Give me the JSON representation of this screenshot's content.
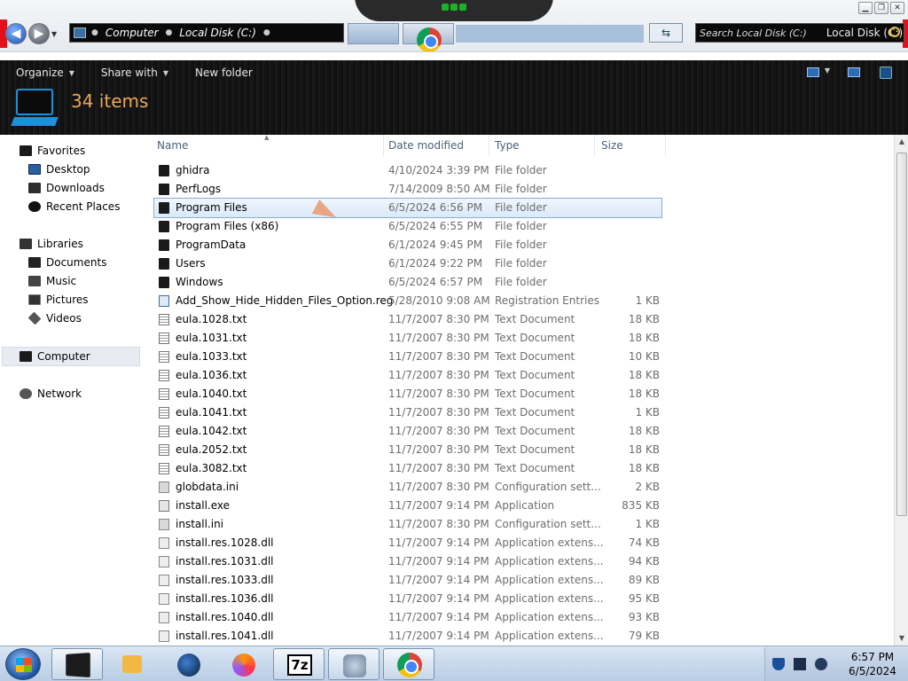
{
  "address": {
    "crumbs": [
      "Computer",
      "Local Disk (C:)"
    ],
    "search_placeholder": "Search Local Disk (C:)",
    "search_location": "Local Disk (C:)"
  },
  "toolbar": {
    "organize": "Organize",
    "share_with": "Share with",
    "new_folder": "New folder"
  },
  "header": {
    "item_count": "34 items"
  },
  "nav": {
    "favorites": "Favorites",
    "desktop": "Desktop",
    "downloads": "Downloads",
    "recent_places": "Recent Places",
    "libraries": "Libraries",
    "documents": "Documents",
    "music": "Music",
    "pictures": "Pictures",
    "videos": "Videos",
    "computer": "Computer",
    "network": "Network"
  },
  "columns": {
    "name": "Name",
    "date": "Date modified",
    "type": "Type",
    "size": "Size"
  },
  "files": [
    {
      "name": "ghidra",
      "date": "4/10/2024 3:39 PM",
      "type": "File folder",
      "size": "",
      "icon": "folder-icon"
    },
    {
      "name": "PerfLogs",
      "date": "7/14/2009 8:50 AM",
      "type": "File folder",
      "size": "",
      "icon": "folder-icon"
    },
    {
      "name": "Program Files",
      "date": "6/5/2024 6:56 PM",
      "type": "File folder",
      "size": "",
      "icon": "folder-icon",
      "selected": true
    },
    {
      "name": "Program Files (x86)",
      "date": "6/5/2024 6:55 PM",
      "type": "File folder",
      "size": "",
      "icon": "folder-icon"
    },
    {
      "name": "ProgramData",
      "date": "6/1/2024 9:45 PM",
      "type": "File folder",
      "size": "",
      "icon": "folder-icon"
    },
    {
      "name": "Users",
      "date": "6/1/2024 9:22 PM",
      "type": "File folder",
      "size": "",
      "icon": "folder-icon"
    },
    {
      "name": "Windows",
      "date": "6/5/2024 6:57 PM",
      "type": "File folder",
      "size": "",
      "icon": "folder-icon"
    },
    {
      "name": "Add_Show_Hide_Hidden_Files_Option.reg",
      "date": "5/28/2010 9:08 AM",
      "type": "Registration Entries",
      "size": "1 KB",
      "icon": "registry-file-icon"
    },
    {
      "name": "eula.1028.txt",
      "date": "11/7/2007 8:30 PM",
      "type": "Text Document",
      "size": "18 KB",
      "icon": "text-file-icon"
    },
    {
      "name": "eula.1031.txt",
      "date": "11/7/2007 8:30 PM",
      "type": "Text Document",
      "size": "18 KB",
      "icon": "text-file-icon"
    },
    {
      "name": "eula.1033.txt",
      "date": "11/7/2007 8:30 PM",
      "type": "Text Document",
      "size": "10 KB",
      "icon": "text-file-icon"
    },
    {
      "name": "eula.1036.txt",
      "date": "11/7/2007 8:30 PM",
      "type": "Text Document",
      "size": "18 KB",
      "icon": "text-file-icon"
    },
    {
      "name": "eula.1040.txt",
      "date": "11/7/2007 8:30 PM",
      "type": "Text Document",
      "size": "18 KB",
      "icon": "text-file-icon"
    },
    {
      "name": "eula.1041.txt",
      "date": "11/7/2007 8:30 PM",
      "type": "Text Document",
      "size": "1 KB",
      "icon": "text-file-icon"
    },
    {
      "name": "eula.1042.txt",
      "date": "11/7/2007 8:30 PM",
      "type": "Text Document",
      "size": "18 KB",
      "icon": "text-file-icon"
    },
    {
      "name": "eula.2052.txt",
      "date": "11/7/2007 8:30 PM",
      "type": "Text Document",
      "size": "18 KB",
      "icon": "text-file-icon"
    },
    {
      "name": "eula.3082.txt",
      "date": "11/7/2007 8:30 PM",
      "type": "Text Document",
      "size": "18 KB",
      "icon": "text-file-icon"
    },
    {
      "name": "globdata.ini",
      "date": "11/7/2007 8:30 PM",
      "type": "Configuration sett...",
      "size": "2 KB",
      "icon": "config-file-icon"
    },
    {
      "name": "install.exe",
      "date": "11/7/2007 9:14 PM",
      "type": "Application",
      "size": "835 KB",
      "icon": "application-icon"
    },
    {
      "name": "install.ini",
      "date": "11/7/2007 8:30 PM",
      "type": "Configuration sett...",
      "size": "1 KB",
      "icon": "config-file-icon"
    },
    {
      "name": "install.res.1028.dll",
      "date": "11/7/2007 9:14 PM",
      "type": "Application extens...",
      "size": "74 KB",
      "icon": "dll-file-icon"
    },
    {
      "name": "install.res.1031.dll",
      "date": "11/7/2007 9:14 PM",
      "type": "Application extens...",
      "size": "94 KB",
      "icon": "dll-file-icon"
    },
    {
      "name": "install.res.1033.dll",
      "date": "11/7/2007 9:14 PM",
      "type": "Application extens...",
      "size": "89 KB",
      "icon": "dll-file-icon"
    },
    {
      "name": "install.res.1036.dll",
      "date": "11/7/2007 9:14 PM",
      "type": "Application extens...",
      "size": "95 KB",
      "icon": "dll-file-icon"
    },
    {
      "name": "install.res.1040.dll",
      "date": "11/7/2007 9:14 PM",
      "type": "Application extens...",
      "size": "93 KB",
      "icon": "dll-file-icon"
    },
    {
      "name": "install.res.1041.dll",
      "date": "11/7/2007 9:14 PM",
      "type": "Application extens...",
      "size": "79 KB",
      "icon": "dll-file-icon"
    }
  ],
  "taskbar": {
    "seven_zip": "7z",
    "time": "6:57 PM",
    "date": "6/5/2024"
  },
  "colors": {
    "item_count": "#e9a85a",
    "selection_border": "#84acdd",
    "column_header": "#4c607a",
    "accent_red": "#e3101a"
  }
}
